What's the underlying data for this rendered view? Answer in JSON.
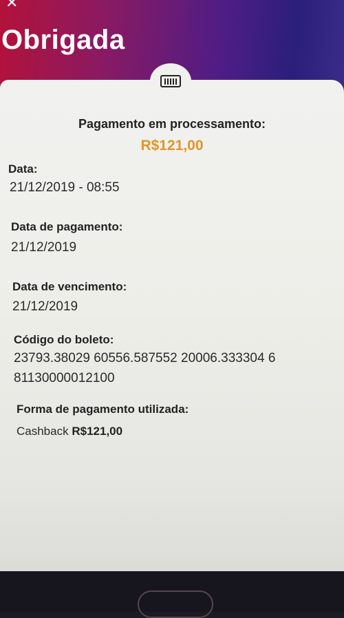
{
  "header": {
    "title": "Obrigada",
    "close_icon": "close-icon"
  },
  "card": {
    "badge_icon": "barcode-icon",
    "status_text": "Pagamento em processamento:",
    "amount": "R$121,00",
    "amount_color": "#e0962a",
    "fields": {
      "date_label": "Data:",
      "date_value": "21/12/2019 - 08:55",
      "payment_date_label": "Data de pagamento:",
      "payment_date_value": "21/12/2019",
      "due_date_label": "Data de vencimento:",
      "due_date_value": "21/12/2019",
      "boleto_label": "Código do boleto:",
      "boleto_line1": "23793.38029 60556.587552 20006.333304 6",
      "boleto_line2": "81130000012100",
      "payment_method_label": "Forma de pagamento utilizada:",
      "payment_method_name": "Cashback",
      "payment_method_amount": "R$121,00"
    }
  }
}
